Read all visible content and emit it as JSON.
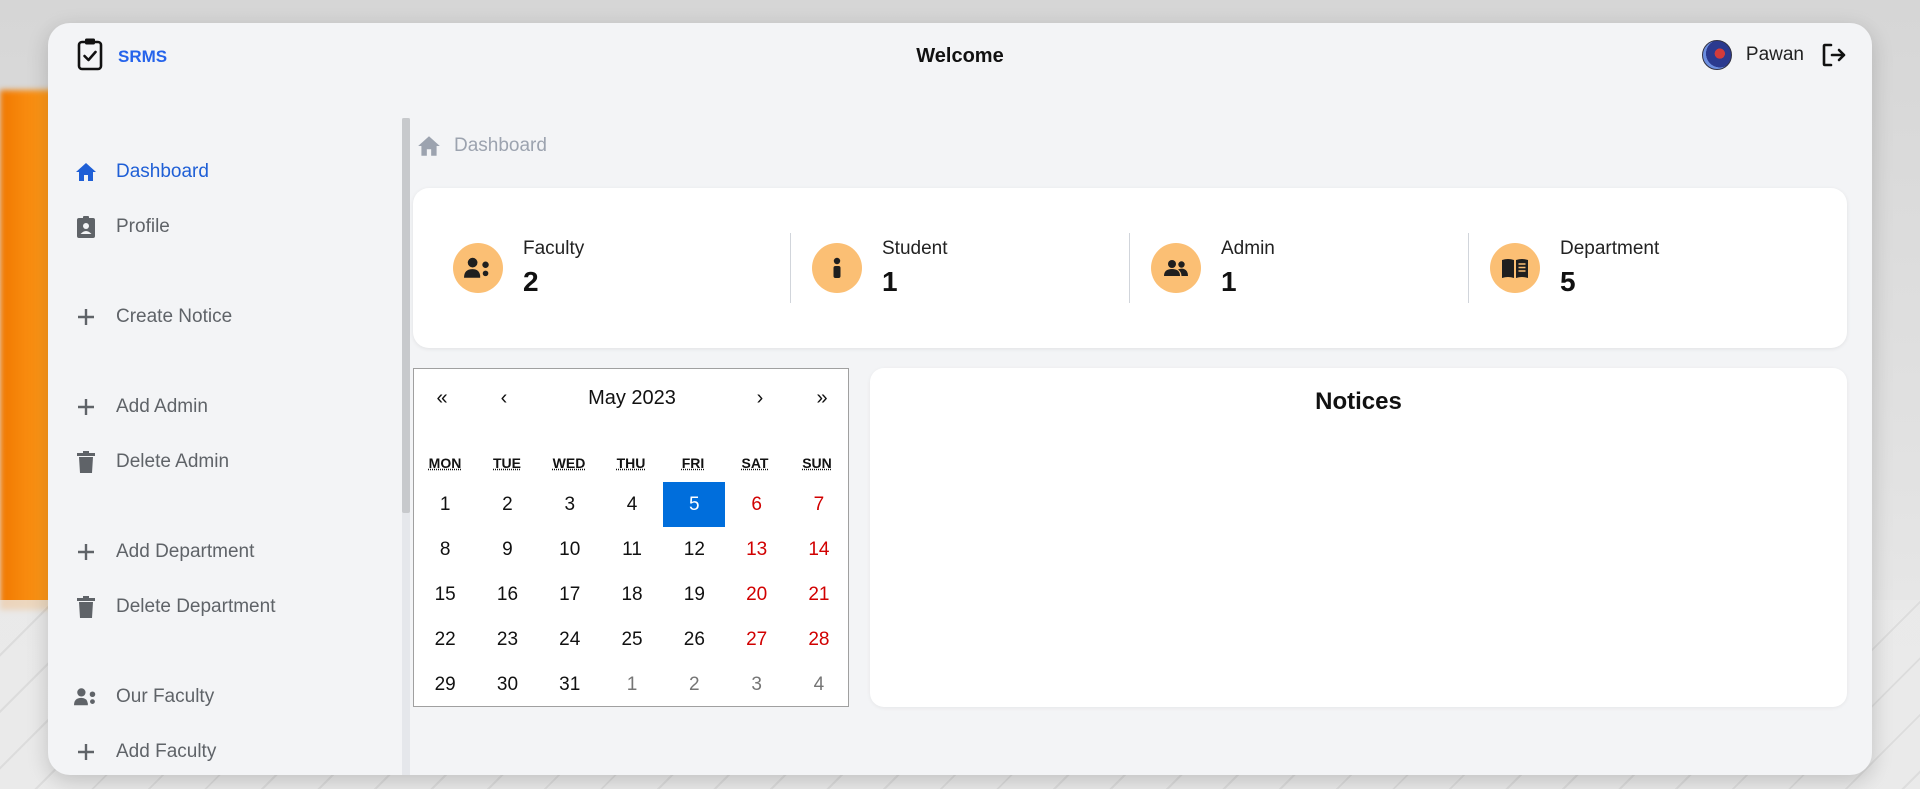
{
  "app": {
    "title": "SRMS"
  },
  "header": {
    "welcome": "Welcome",
    "user_name": "Pawan"
  },
  "sidebar": {
    "items": [
      {
        "label": "Dashboard",
        "icon": "home-icon"
      },
      {
        "label": "Profile",
        "icon": "id-badge-icon"
      },
      {
        "label": "Create Notice",
        "icon": "plus-icon"
      },
      {
        "label": "Add Admin",
        "icon": "plus-icon"
      },
      {
        "label": "Delete Admin",
        "icon": "trash-icon"
      },
      {
        "label": "Add Department",
        "icon": "plus-icon"
      },
      {
        "label": "Delete Department",
        "icon": "trash-icon"
      },
      {
        "label": "Our Faculty",
        "icon": "faculty-icon"
      },
      {
        "label": "Add Faculty",
        "icon": "plus-icon"
      }
    ]
  },
  "breadcrumb": {
    "label": "Dashboard"
  },
  "stats": [
    {
      "label": "Faculty",
      "value": "2",
      "icon": "faculty-icon"
    },
    {
      "label": "Student",
      "value": "1",
      "icon": "student-icon"
    },
    {
      "label": "Admin",
      "value": "1",
      "icon": "admin-icon"
    },
    {
      "label": "Department",
      "value": "5",
      "icon": "book-icon"
    }
  ],
  "calendar": {
    "month_label": "May 2023",
    "nav": {
      "prev2": "«",
      "prev": "‹",
      "next": "›",
      "next2": "»"
    },
    "weekdays": [
      "MON",
      "TUE",
      "WED",
      "THU",
      "FRI",
      "SAT",
      "SUN"
    ],
    "days": [
      {
        "d": "1"
      },
      {
        "d": "2"
      },
      {
        "d": "3"
      },
      {
        "d": "4"
      },
      {
        "d": "5",
        "today": true
      },
      {
        "d": "6",
        "weekend": true
      },
      {
        "d": "7",
        "weekend": true
      },
      {
        "d": "8"
      },
      {
        "d": "9"
      },
      {
        "d": "10"
      },
      {
        "d": "11"
      },
      {
        "d": "12"
      },
      {
        "d": "13",
        "weekend": true
      },
      {
        "d": "14",
        "weekend": true
      },
      {
        "d": "15"
      },
      {
        "d": "16"
      },
      {
        "d": "17"
      },
      {
        "d": "18"
      },
      {
        "d": "19"
      },
      {
        "d": "20",
        "weekend": true
      },
      {
        "d": "21",
        "weekend": true
      },
      {
        "d": "22"
      },
      {
        "d": "23"
      },
      {
        "d": "24"
      },
      {
        "d": "25"
      },
      {
        "d": "26"
      },
      {
        "d": "27",
        "weekend": true
      },
      {
        "d": "28",
        "weekend": true
      },
      {
        "d": "29"
      },
      {
        "d": "30"
      },
      {
        "d": "31"
      },
      {
        "d": "1",
        "neighbor": true
      },
      {
        "d": "2",
        "neighbor": true
      },
      {
        "d": "3",
        "neighbor": true
      },
      {
        "d": "4",
        "neighbor": true
      }
    ]
  },
  "notices": {
    "title": "Notices"
  },
  "colors": {
    "accent": "#2563eb",
    "stat_icon_bg": "#fbbf74",
    "today": "#006edc",
    "weekend": "#d10000"
  }
}
